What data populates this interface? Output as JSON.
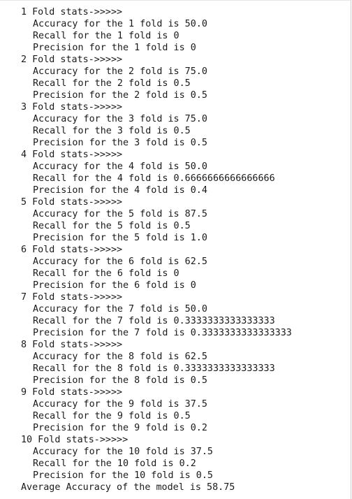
{
  "output": {
    "folds": [
      {
        "header": "1 Fold stats->>>>>",
        "accuracy": "Accuracy for the 1 fold is 50.0",
        "recall": "Recall for the 1 fold is 0",
        "precision": "Precision for the 1 fold is 0"
      },
      {
        "header": "2 Fold stats->>>>>",
        "accuracy": "Accuracy for the 2 fold is 75.0",
        "recall": "Recall for the 2 fold is 0.5",
        "precision": "Precision for the 2 fold is 0.5"
      },
      {
        "header": "3 Fold stats->>>>>",
        "accuracy": "Accuracy for the 3 fold is 75.0",
        "recall": "Recall for the 3 fold is 0.5",
        "precision": "Precision for the 3 fold is 0.5"
      },
      {
        "header": "4 Fold stats->>>>>",
        "accuracy": "Accuracy for the 4 fold is 50.0",
        "recall": "Recall for the 4 fold is 0.6666666666666666",
        "precision": "Precision for the 4 fold is 0.4"
      },
      {
        "header": "5 Fold stats->>>>>",
        "accuracy": "Accuracy for the 5 fold is 87.5",
        "recall": "Recall for the 5 fold is 0.5",
        "precision": "Precision for the 5 fold is 1.0"
      },
      {
        "header": "6 Fold stats->>>>>",
        "accuracy": "Accuracy for the 6 fold is 62.5",
        "recall": "Recall for the 6 fold is 0",
        "precision": "Precision for the 6 fold is 0"
      },
      {
        "header": "7 Fold stats->>>>>",
        "accuracy": "Accuracy for the 7 fold is 50.0",
        "recall": "Recall for the 7 fold is 0.3333333333333333",
        "precision": "Precision for the 7 fold is 0.3333333333333333"
      },
      {
        "header": "8 Fold stats->>>>>",
        "accuracy": "Accuracy for the 8 fold is 62.5",
        "recall": "Recall for the 8 fold is 0.3333333333333333",
        "precision": "Precision for the 8 fold is 0.5"
      },
      {
        "header": "9 Fold stats->>>>>",
        "accuracy": "Accuracy for the 9 fold is 37.5",
        "recall": "Recall for the 9 fold is 0.5",
        "precision": "Precision for the 9 fold is 0.2"
      },
      {
        "header": "10 Fold stats->>>>>",
        "accuracy": "Accuracy for the 10 fold is 37.5",
        "recall": "Recall for the 10 fold is 0.2",
        "precision": "Precision for the 10 fold is 0.5"
      }
    ],
    "average": "Average Accuracy of the model is 58.75"
  }
}
